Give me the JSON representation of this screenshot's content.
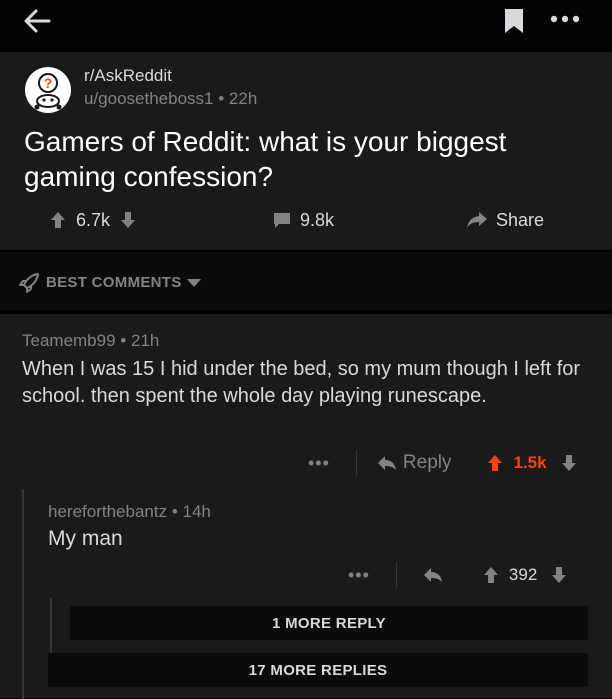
{
  "topbar": {
    "back": "back-arrow-icon",
    "bookmark": "bookmark-icon",
    "more": "more-options-icon"
  },
  "post": {
    "subreddit": "r/AskReddit",
    "author": "u/goosetheboss1",
    "age": "22h",
    "title": "Gamers of Reddit: what is your biggest gaming confession?",
    "score": "6.7k",
    "comments": "9.8k",
    "share_label": "Share"
  },
  "sort": {
    "label": "BEST COMMENTS"
  },
  "comments": [
    {
      "author": "Teamemb99",
      "age": "21h",
      "body": "When I was 15 I hid under the bed, so my mum though I left for school. then spent the whole day playing runescape.",
      "reply_label": "Reply",
      "score": "1.5k",
      "upvoted": true
    },
    {
      "author": "hereforthebantz",
      "age": "14h",
      "body": "My man",
      "score": "392",
      "upvoted": false
    }
  ],
  "more": {
    "one_more": "1 MORE REPLY",
    "seventeen_more": "17 MORE REPLIES"
  },
  "colors": {
    "upvote_active": "#ff4500",
    "muted": "#818384",
    "text": "#d7dadc",
    "card": "#1a1a1b"
  }
}
